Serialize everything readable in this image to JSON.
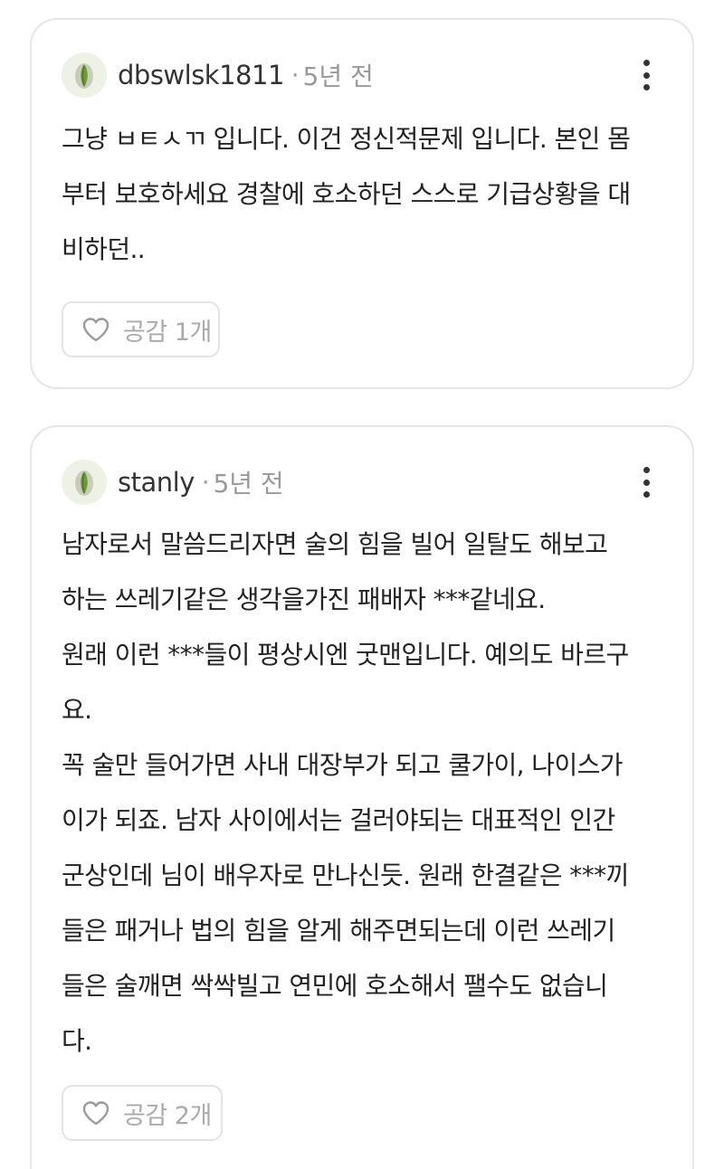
{
  "comments": [
    {
      "author": "dbswlsk1811",
      "separator": "·",
      "time": "5년 전",
      "body_lines": [
        "그냥 ㅂㅌㅅㄲ 입니다. 이건 정신적문제 입니다. 본인 몸",
        "부터 보호하세요 경찰에 호소하던 스스로 기급상황을 대",
        "비하던.."
      ],
      "like_label": "공감 1개"
    },
    {
      "author": "stanly",
      "separator": "·",
      "time": "5년 전",
      "body_lines": [
        "남자로서 말씀드리자면 술의 힘을 빌어 일탈도 해보고",
        "하는 쓰레기같은 생각을가진 패배자 ***같네요.",
        "원래 이런 ***들이 평상시엔 굿맨입니다. 예의도 바르구",
        "요.",
        "꼭 술만 들어가면 사내 대장부가 되고 쿨가이, 나이스가",
        "이가 되죠. 남자 사이에서는 걸러야되는 대표적인 인간",
        "군상인데 님이 배우자로 만나신듯. 원래 한결같은 ***끼",
        "들은 패거나 법의 힘을 알게 해주면되는데 이런 쓰레기",
        "들은 술깨면 싹싹빌고 연민에 호소해서 팰수도 없습니",
        "다."
      ],
      "like_label": "공감 2개"
    }
  ],
  "icons": {
    "avatar": "pistachio-avatar-icon",
    "more": "more-vertical-icon",
    "like": "heart-outline-icon"
  },
  "colors": {
    "card_border": "#e6e6e6",
    "meta_gray": "#999999",
    "like_gray": "#aaaaaa",
    "avatar_bg": "#eef2e6",
    "avatar_shell": "#c9cdb8",
    "avatar_nut": "#6e9a3c"
  }
}
